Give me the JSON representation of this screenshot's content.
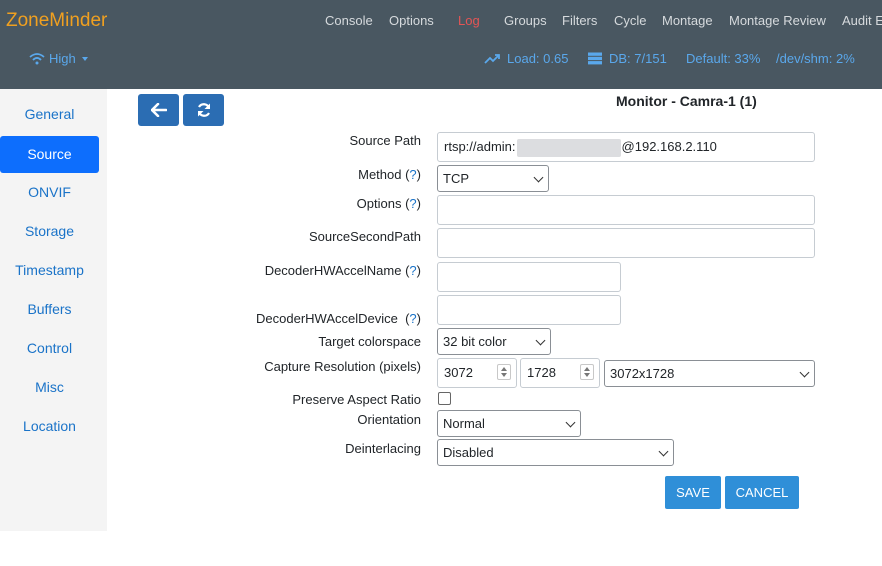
{
  "app": {
    "brand": "ZoneMinder"
  },
  "nav": {
    "items": [
      {
        "label": "Console",
        "active": false
      },
      {
        "label": "Options",
        "active": false
      },
      {
        "label": "Log",
        "active": true
      },
      {
        "label": "Groups",
        "active": false
      },
      {
        "label": "Filters",
        "active": false
      },
      {
        "label": "Cycle",
        "active": false
      },
      {
        "label": "Montage",
        "active": false
      },
      {
        "label": "Montage Review",
        "active": false
      },
      {
        "label": "Audit E",
        "active": false
      }
    ]
  },
  "status": {
    "bandwidth": "High",
    "load": "Load: 0.65",
    "db": "DB: 7/151",
    "default_storage": "Default: 33%",
    "shm": "/dev/shm: 2%",
    "accent_color": "#5aa8ec",
    "active_log_color": "#e55555"
  },
  "sidebar": {
    "items": [
      {
        "label": "General"
      },
      {
        "label": "Source"
      },
      {
        "label": "ONVIF"
      },
      {
        "label": "Storage"
      },
      {
        "label": "Timestamp"
      },
      {
        "label": "Buffers"
      },
      {
        "label": "Control"
      },
      {
        "label": "Misc"
      },
      {
        "label": "Location"
      }
    ],
    "active": "Source"
  },
  "toolbar": {
    "back_icon": "arrow-left-icon",
    "refresh_icon": "refresh-icon"
  },
  "monitor": {
    "title": "Monitor - Camra-1 (1)"
  },
  "form": {
    "source_path": {
      "label": "Source Path",
      "prefix": "rtsp://admin:",
      "suffix": "@192.168.2.110"
    },
    "method": {
      "label": "Method (",
      "help": "?",
      "close": ")",
      "value": "TCP"
    },
    "options": {
      "label": "Options (",
      "help": "?",
      "close": ")",
      "value": ""
    },
    "source_second_path": {
      "label": "SourceSecondPath",
      "value": ""
    },
    "decoder_hw_accel_name": {
      "label": "DecoderHWAccelName (",
      "help": "?",
      "close": ")",
      "value": ""
    },
    "decoder_hw_accel_device": {
      "label": "DecoderHWAccelDevice  (",
      "help": "?",
      "close": ")",
      "value": ""
    },
    "target_colorspace": {
      "label": "Target colorspace",
      "value": "32 bit color"
    },
    "capture_resolution": {
      "label": "Capture Resolution (pixels)",
      "width": "3072",
      "height": "1728",
      "preset": "3072x1728"
    },
    "preserve_aspect_ratio": {
      "label": "Preserve Aspect Ratio",
      "checked": false
    },
    "orientation": {
      "label": "Orientation",
      "value": "Normal"
    },
    "deinterlacing": {
      "label": "Deinterlacing",
      "value": "Disabled"
    }
  },
  "actions": {
    "save": "SAVE",
    "cancel": "CANCEL"
  }
}
